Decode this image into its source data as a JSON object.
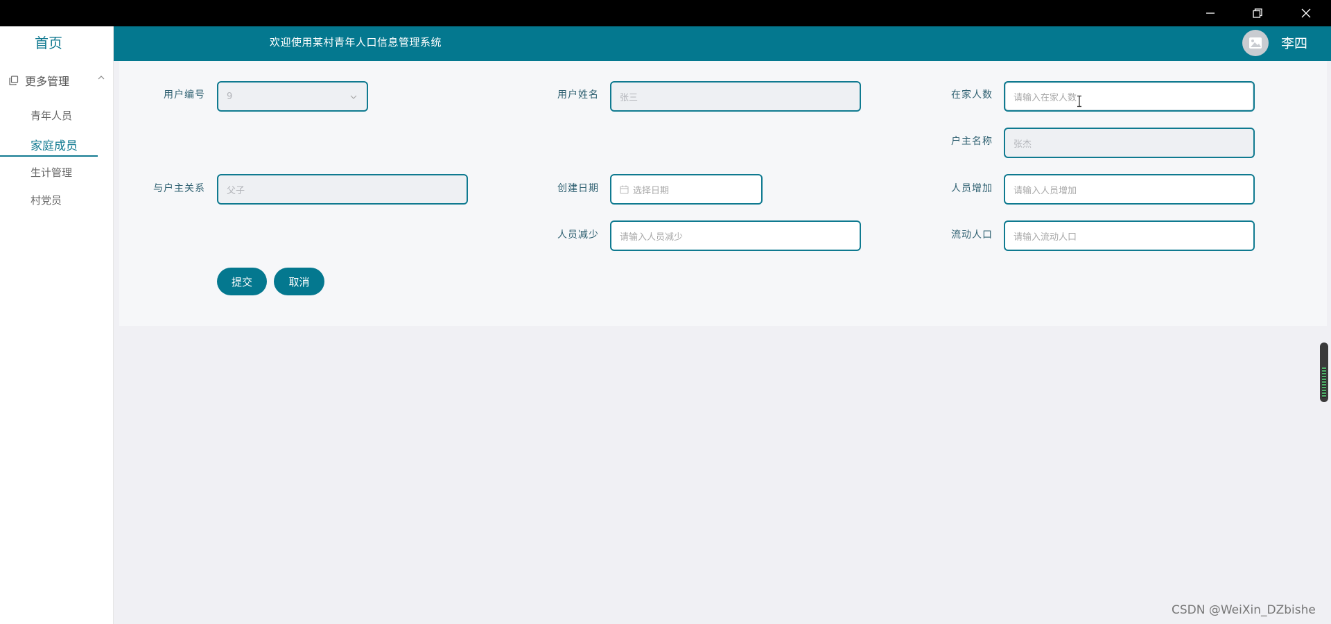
{
  "window": {
    "controls": [
      "minimize",
      "restore",
      "close"
    ]
  },
  "sidebar": {
    "home": "首页",
    "group": {
      "label": "更多管理",
      "icon": "copy-icon",
      "expanded": true
    },
    "items": [
      {
        "label": "青年人员",
        "active": false
      },
      {
        "label": "家庭成员",
        "active": true
      },
      {
        "label": "生计管理",
        "active": false
      },
      {
        "label": "村党员",
        "active": false
      }
    ]
  },
  "header": {
    "title": "欢迎使用某村青年人口信息管理系统",
    "username": "李四",
    "avatar_icon": "image-icon"
  },
  "form": {
    "fields": {
      "user_no": {
        "label": "用户编号",
        "value": "9"
      },
      "user_name": {
        "label": "用户姓名",
        "value": "张三"
      },
      "family_count": {
        "label": "在家人数",
        "placeholder": "请输入在家人数"
      },
      "householder_name": {
        "label": "户主名称",
        "value": "张杰"
      },
      "relation": {
        "label": "与户主关系",
        "value": "父子"
      },
      "create_date": {
        "label": "创建日期",
        "placeholder": "选择日期"
      },
      "member_add": {
        "label": "人员增加",
        "placeholder": "请输入人员增加"
      },
      "member_reduce": {
        "label": "人员减少",
        "placeholder": "请输入人员减少"
      },
      "floating_pop": {
        "label": "流动人口",
        "placeholder": "请输入流动人口"
      }
    },
    "submit_label": "提交",
    "cancel_label": "取消"
  },
  "colors": {
    "primary": "#04788f",
    "sidebar_active": "#127a91",
    "titlebar": "#000000",
    "page_bg": "#f0f0f4"
  },
  "watermark": "CSDN @WeiXin_DZbishe"
}
